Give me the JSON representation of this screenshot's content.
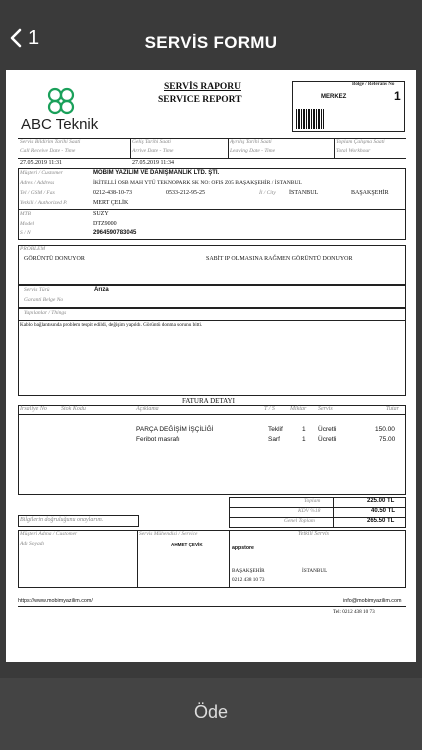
{
  "nav": {
    "back_count": "1",
    "title": "SERVİS FORMU"
  },
  "company": {
    "name": "ABC Teknik",
    "brand_color": "#1aa05a"
  },
  "report": {
    "title_tr": "SERVİS RAPORU",
    "title_en": "SERVICE REPORT",
    "ref_label": "Bölge / Referans No",
    "region": "MERKEZ",
    "ref_no": "1"
  },
  "dates": {
    "call_label_tr": "Servis Bildirim Tarihi Saati",
    "call_label_en": "Call Receive Date - Time",
    "call_value": "27.05.2019 11:31",
    "arrive_label_tr": "Geliş Tarihi Saati",
    "arrive_label_en": "Arrive Date - Time",
    "arrive_value": "27.05.2019 11:34",
    "leave_label_tr": "Ayrılış Tarihi Saati",
    "leave_label_en": "Leaving Date - Time",
    "work_label_tr": "Toplam Çalışma Saati",
    "work_label_en": "Total Workhour"
  },
  "customer": {
    "customer_label": "Müşteri / Customer",
    "customer_value": "MOBIM YAZILIM VE DANIŞMANLIK LTD. ŞTİ.",
    "address_label": "Adres / Address",
    "address_value": "İKİTELLİ OSB MAH YTÜ TEKNOPARK SK NO: OFIS Z05 BAŞAKŞEHİR / İSTANBUL",
    "phone_label": "Tel / GSM / Fax",
    "phone1": "0212-438-10-73",
    "phone2": "0533-212-95-25",
    "city_label": "İl / City",
    "city": "İSTANBUL",
    "district": "BAŞAKŞEHİR",
    "auth_label": "Yetkili / Authorized P.",
    "auth_value": "MERT ÇELİK",
    "mtb_label": "MTB",
    "mtb_value": "SUZY",
    "model_label": "Model",
    "model_value": "DTZ9000",
    "sn_label": "S / N",
    "sn_value": "2964590783045"
  },
  "problem": {
    "label": "PROBLEM",
    "value": "GÖRÜNTÜ DONUYOR",
    "note": "SABİT IP OLMASINA RAĞMEN GÖRÜNTÜ DONUYOR"
  },
  "service": {
    "type_label": "Servis Türü",
    "type_value": "Arıza",
    "warranty_label": "Garanti Belge No",
    "done_label": "Yapılanlar / Things",
    "done_value": "Kablo bağlantısında problem tespit edildi, değişim yapıldı. Görüntü donma sorunu bitti."
  },
  "invoice": {
    "title": "FATURA DETAYI",
    "columns": [
      "İrsaliye No",
      "Stok Kodu",
      "Açıklama",
      "T / S",
      "Miktar",
      "Servis",
      "Tutar"
    ],
    "rows": [
      {
        "desc": "PARÇA DEĞİŞİM İŞÇİLİĞİ",
        "ts": "Teklif",
        "qty": "1",
        "service": "Ücretli",
        "amount": "150.00"
      },
      {
        "desc": "Feribot masrafı",
        "ts": "Sarf",
        "qty": "1",
        "service": "Ücretli",
        "amount": "75.00"
      }
    ]
  },
  "totals": {
    "total_label": "Toplam",
    "total_value": "225.00 TL",
    "vat_label": "KDV %18",
    "vat_value": "40.50 TL",
    "grand_label": "Genel Toplam",
    "grand_value": "265.50 TL",
    "confirm_text": "Bilgilerin doğruluğunu onaylarım."
  },
  "signatures": {
    "customer_label": "Müşteri Adına / Customer",
    "name_label": "Adı Soyadı",
    "engineer_label": "Servis Mühendisi / Service",
    "engineer_name": "AHMET ÇEVİK",
    "authorized_label": "Yetkili Servis",
    "service_name": "appstore",
    "service_district": "BAŞAKŞEHİR",
    "service_city": "İSTANBUL",
    "service_phone": "0212 438 10 73"
  },
  "footer": {
    "website": "https://www.mobimyazilim.com/",
    "email": "info@mobimyazilim.com",
    "tel": "Tel:   0212 438 10 73"
  },
  "bottom": {
    "pay_label": "Öde"
  }
}
